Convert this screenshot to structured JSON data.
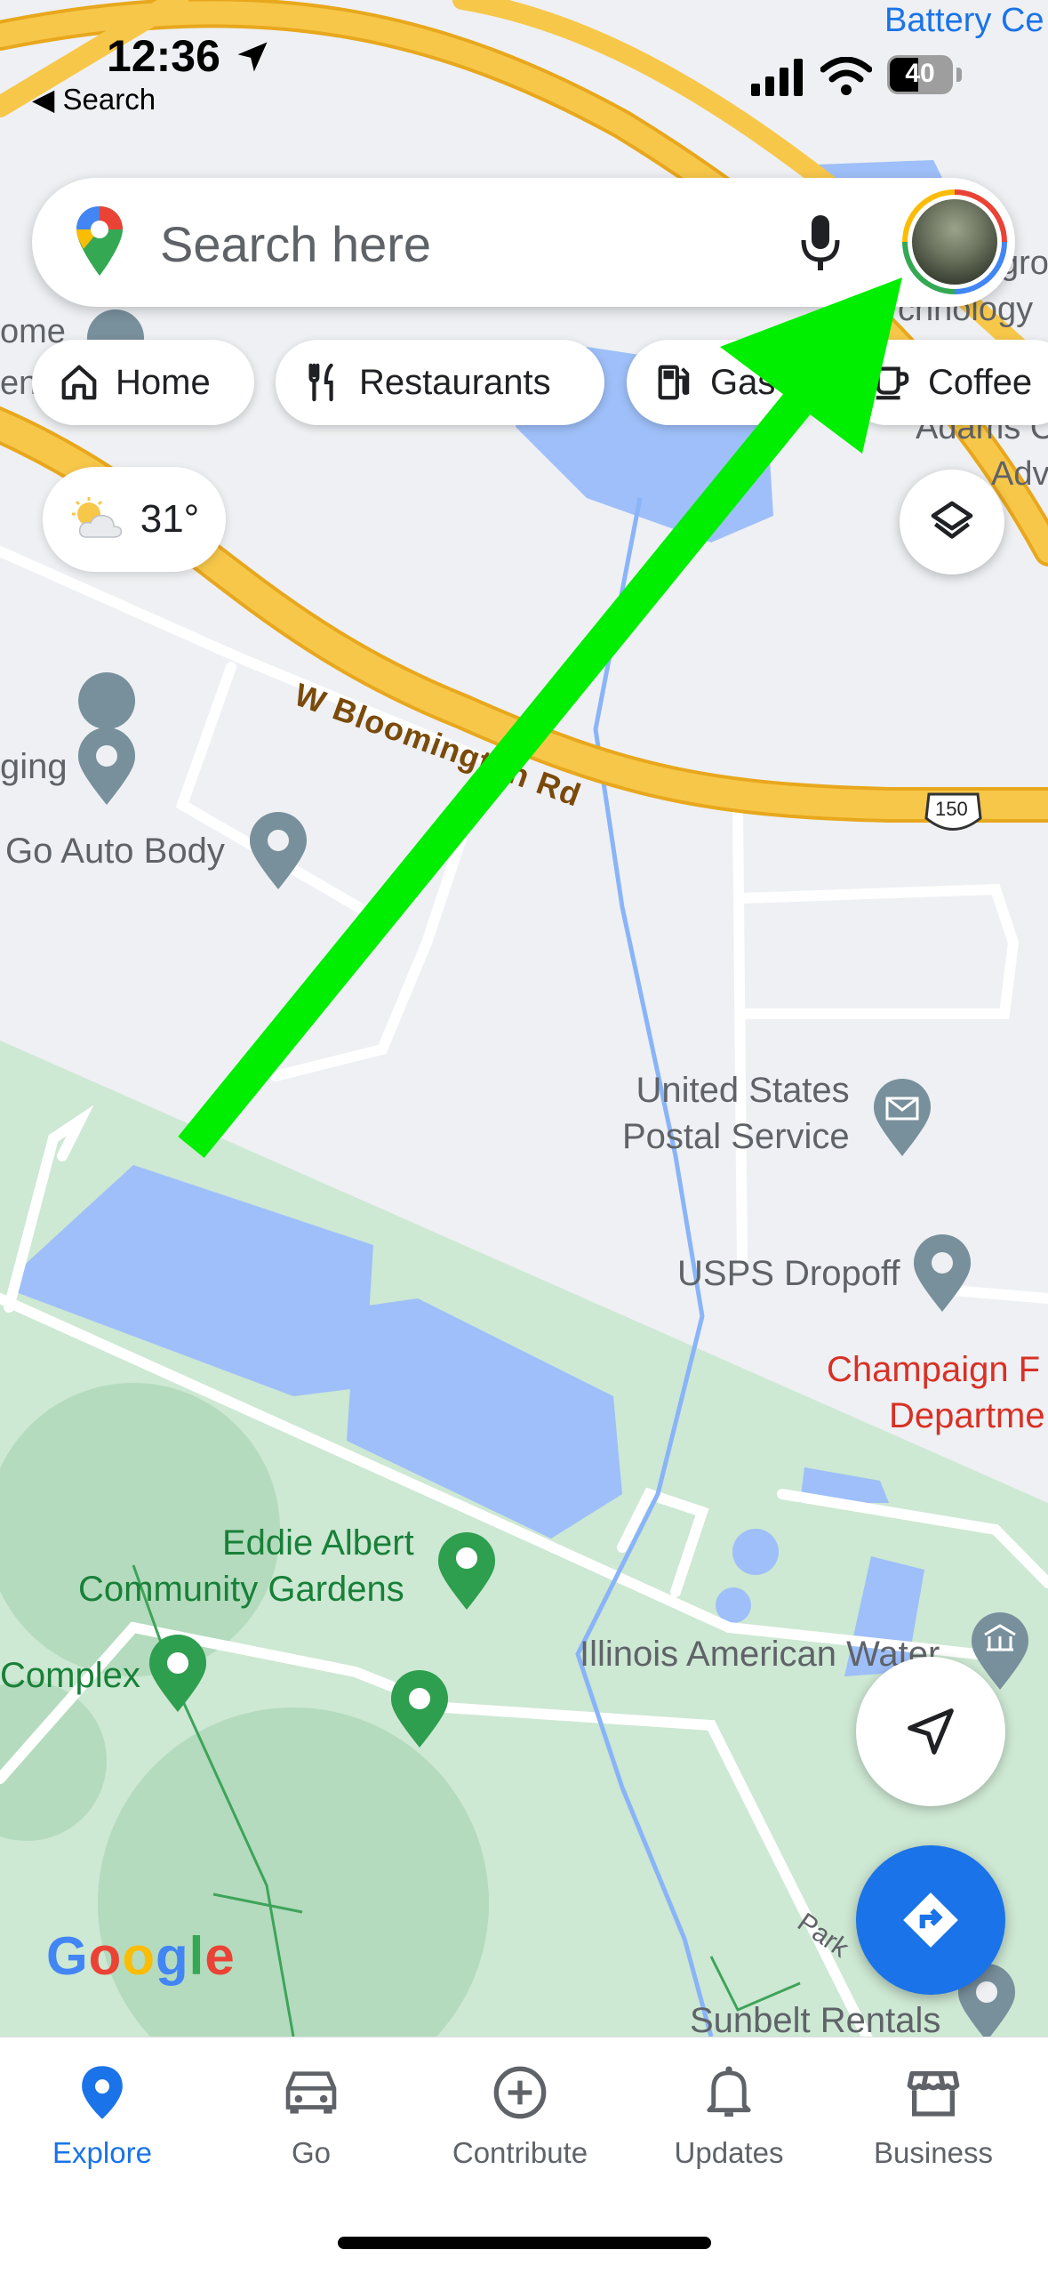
{
  "status_bar": {
    "time": "12:36",
    "back_label": "Search",
    "battery": "40"
  },
  "search": {
    "placeholder": "Search here"
  },
  "chips": [
    {
      "label": "Home",
      "icon": "home-icon"
    },
    {
      "label": "Restaurants",
      "icon": "restaurant-icon"
    },
    {
      "label": "Gas",
      "icon": "gas-station-icon"
    },
    {
      "label": "Coffee",
      "icon": "coffee-icon"
    }
  ],
  "weather": {
    "temp": "31°",
    "icon": "partly-cloudy-icon"
  },
  "map": {
    "road": "W Bloomington Rd",
    "route_shield": "150",
    "park_road": "Park",
    "labels": {
      "battery_center": "Battery Ce",
      "technology_1": "gro",
      "technology_2": "chnology",
      "adams_1": "Adams C",
      "adams_2": "Adv",
      "home_partial": "ome",
      "en_partial": "en",
      "charging": "ging",
      "auto_body": "Go Auto Body",
      "usps": "United States\nPostal Service",
      "usps_dropoff": "USPS Dropoff",
      "champaign_1": "Champaign F",
      "champaign_2": "Departme",
      "eddie_1": "Eddie Albert",
      "eddie_2": "Community Gardens",
      "complex": "Complex",
      "illinois_water": "Illinois American Water",
      "sunbelt": "Sunbelt Rentals"
    },
    "google_logo": "Google",
    "colors": {
      "land": "#eef0f3",
      "park": "#cde8d3",
      "water": "#9ebff9",
      "highway": "#f7c74a",
      "route_arrow": "#00ee00",
      "brand_blue": "#1a73e8"
    }
  },
  "nav": [
    {
      "label": "Explore",
      "icon": "explore-pin-icon",
      "active": true
    },
    {
      "label": "Go",
      "icon": "car-icon",
      "active": false
    },
    {
      "label": "Contribute",
      "icon": "plus-circle-icon",
      "active": false
    },
    {
      "label": "Updates",
      "icon": "bell-icon",
      "active": false
    },
    {
      "label": "Business",
      "icon": "storefront-icon",
      "active": false
    }
  ]
}
